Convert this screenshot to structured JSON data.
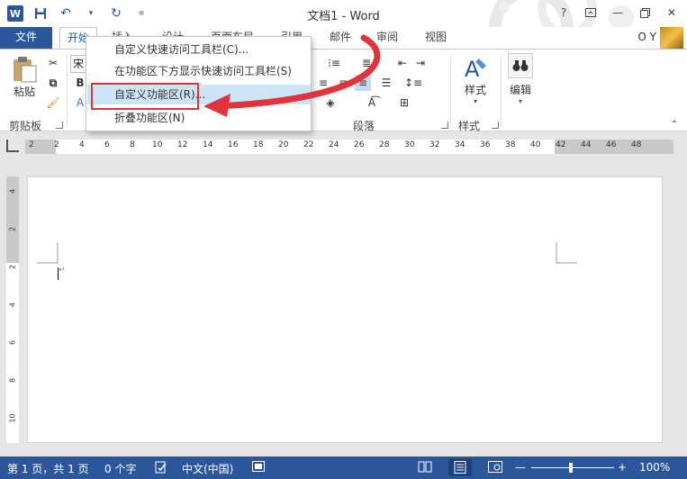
{
  "title_bar": {
    "title": "文档1 - Word",
    "help": "?",
    "minimize": "—",
    "close": "✕"
  },
  "tabs": {
    "file": "文件",
    "home": "开始",
    "insert": "插入",
    "design": "设计",
    "layout": "页面布局",
    "references": "引用",
    "mailings": "邮件",
    "review": "审阅",
    "view": "视图"
  },
  "user": {
    "name": "O Y"
  },
  "ribbon": {
    "paste_label": "粘贴",
    "clipboard_group": "剪贴板",
    "font_box": "宋",
    "paragraph_group": "段落",
    "styles_label": "样式",
    "styles_group": "样式",
    "edit_label": "编辑"
  },
  "dropdown_menu": {
    "items": [
      "自定义快速访问工具栏(C)...",
      "在功能区下方显示快速访问工具栏(S)",
      "自定义功能区(R)...",
      "折叠功能区(N)"
    ],
    "highlighted_index": 2
  },
  "hruler": {
    "numbers": [
      "2",
      "2",
      "4",
      "6",
      "8",
      "10",
      "12",
      "14",
      "16",
      "18",
      "20",
      "22",
      "24",
      "26",
      "28",
      "30",
      "32",
      "34",
      "36",
      "38",
      "40",
      "42",
      "44",
      "46",
      "48"
    ]
  },
  "vruler": {
    "numbers": [
      "4",
      "2",
      "2",
      "4",
      "6",
      "8",
      "10"
    ]
  },
  "status_bar": {
    "page": "第 1 页，共 1 页",
    "words": "0 个字",
    "language": "中文(中国)",
    "zoom": "100%",
    "zoom_out": "—",
    "zoom_in": "+"
  },
  "colors": {
    "accent": "#2b579a",
    "annotation_red": "#e0343a",
    "menu_highlight": "#cde4f7"
  }
}
